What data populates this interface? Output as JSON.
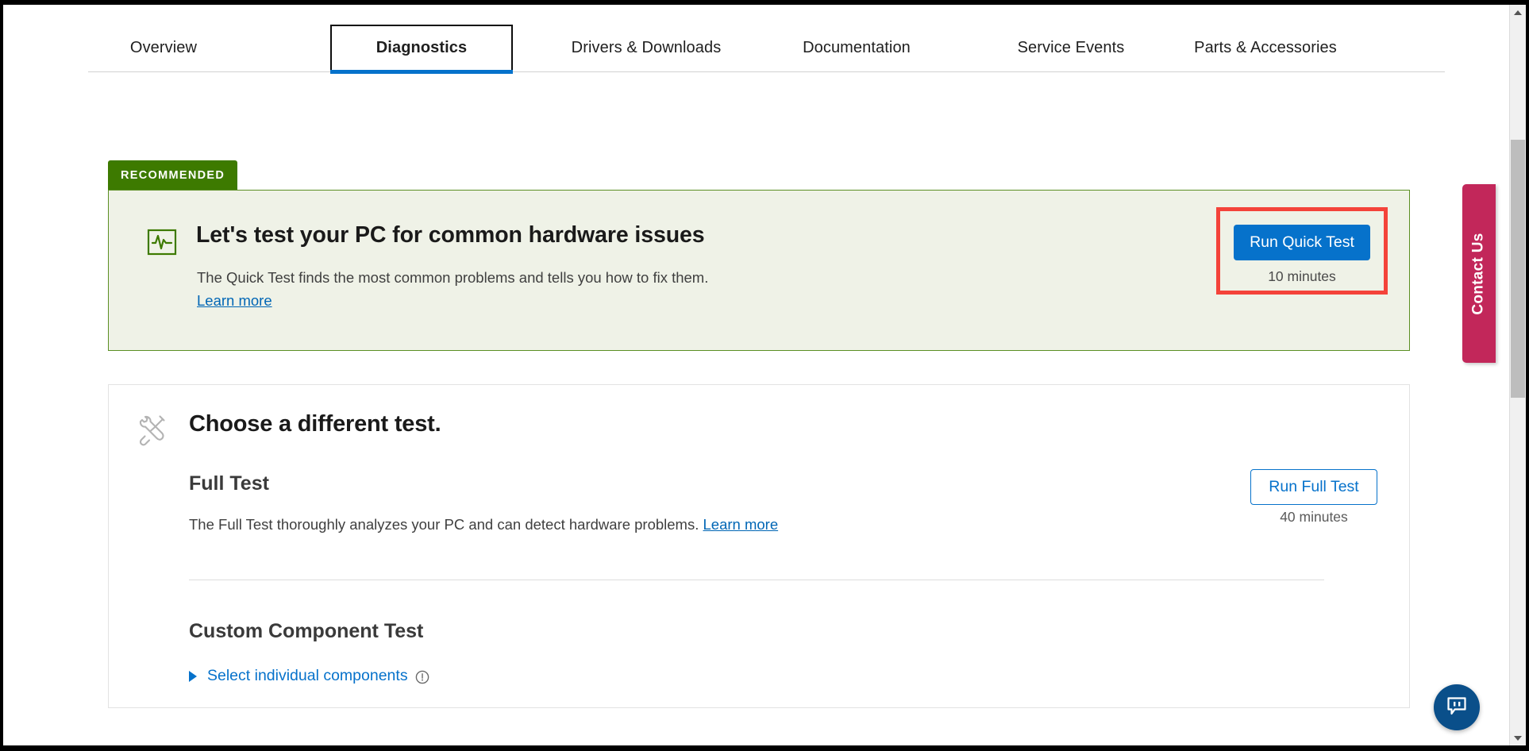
{
  "tabs": [
    {
      "label": "Overview",
      "active": false
    },
    {
      "label": "Diagnostics",
      "active": true
    },
    {
      "label": "Drivers & Downloads",
      "active": false
    },
    {
      "label": "Documentation",
      "active": false
    },
    {
      "label": "Service Events",
      "active": false
    },
    {
      "label": "Parts & Accessories",
      "active": false
    }
  ],
  "recommended_card": {
    "ribbon_label": "RECOMMENDED",
    "icon": "pulse-monitor-icon",
    "title": "Let's test your PC for common hardware issues",
    "description": "The Quick Test finds the most common problems and tells you how to fix them.",
    "learn_more_label": "Learn more",
    "run_button_label": "Run Quick Test",
    "duration": "10 minutes",
    "highlight_color": "#f4433a",
    "accent_color": "#3d7a00",
    "background_color": "#eff2e7",
    "button_color": "#0672cb"
  },
  "choose_card": {
    "icon": "tools-icon",
    "title": "Choose a different test.",
    "tests": [
      {
        "name": "Full Test",
        "description": "The Full Test thoroughly analyzes your PC and can detect hardware problems.",
        "learn_more_label": "Learn more",
        "button_label": "Run Full Test",
        "duration": "40 minutes"
      },
      {
        "name": "Custom Component Test",
        "select_label": "Select individual components",
        "info_icon": "exclamation-circle-icon",
        "caret_icon": "caret-right-icon"
      }
    ]
  },
  "contact_tab": {
    "label": "Contact Us",
    "color": "#c2275a"
  },
  "chat_fab": {
    "icon": "chat-bubble-icon",
    "color": "#0a4f8a"
  },
  "scrollbar": {
    "up_icon": "scroll-up-arrow-icon",
    "down_icon": "scroll-down-arrow-icon",
    "thumb": "scrollbar-thumb"
  },
  "colors": {
    "link": "#0066b5",
    "primary": "#0672cb",
    "green_border": "#5b8f23",
    "page_bg": "#ffffff"
  }
}
